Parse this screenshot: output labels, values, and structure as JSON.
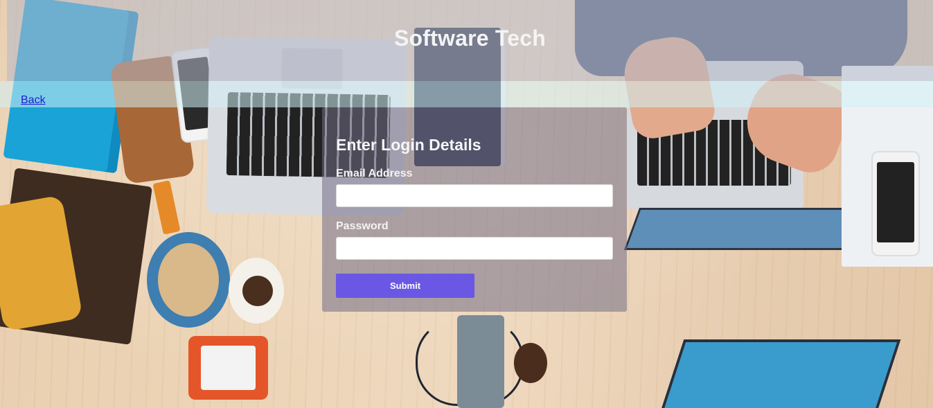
{
  "header": {
    "title": "Software Tech"
  },
  "nav": {
    "back_label": "Back"
  },
  "login": {
    "title": "Enter Login Details",
    "email_label": "Email Address",
    "email_value": "",
    "password_label": "Password",
    "password_value": "",
    "submit_label": "Submit"
  },
  "colors": {
    "submit_button": "#6a57e3",
    "link": "#1a1ad6",
    "title_text": "#f4f4f4"
  }
}
